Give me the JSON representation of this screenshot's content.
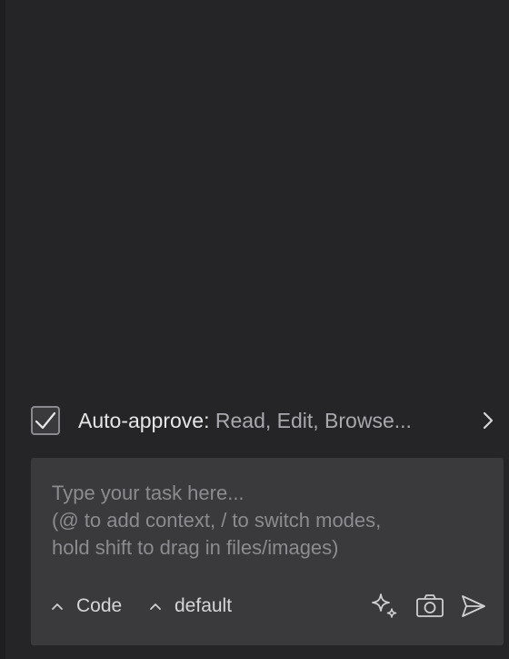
{
  "auto_approve": {
    "checked": true,
    "label": "Auto-approve:",
    "values": "Read, Edit, Browse..."
  },
  "input": {
    "placeholder_lines": [
      "Type your task here...",
      "(@ to add context, / to switch modes,",
      "hold shift to drag in files/images)"
    ]
  },
  "toolbar": {
    "mode_label": "Code",
    "config_label": "default",
    "icons": [
      "sparkle-icon",
      "camera-icon",
      "send-icon"
    ]
  },
  "colors": {
    "background": "#252527",
    "input_background": "#3a3a3c",
    "text_primary": "#e6e6e6",
    "text_secondary": "#a8a8ad",
    "placeholder": "#8c8c90"
  }
}
